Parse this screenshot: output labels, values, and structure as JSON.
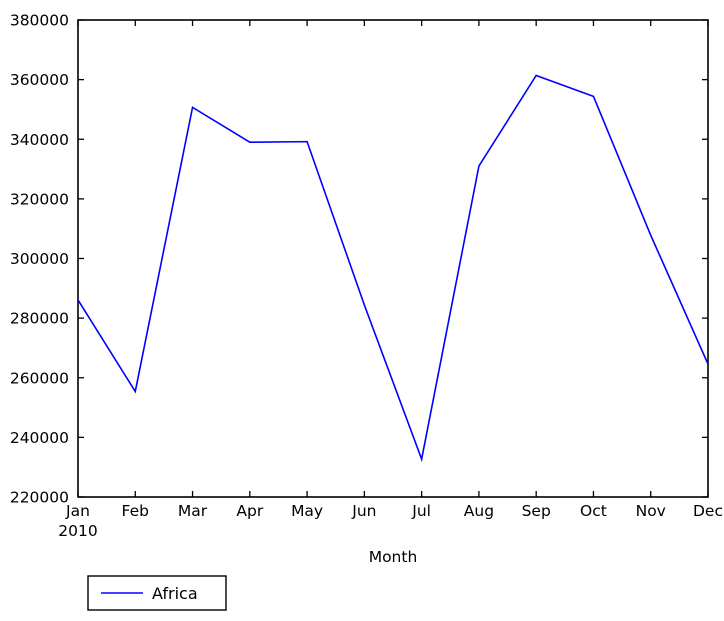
{
  "chart_data": {
    "type": "line",
    "title": "",
    "xlabel": "Month",
    "ylabel": "",
    "x_unit_label": "2010",
    "categories": [
      "Jan",
      "Feb",
      "Mar",
      "Apr",
      "May",
      "Jun",
      "Jul",
      "Aug",
      "Sep",
      "Oct",
      "Nov",
      "Dec"
    ],
    "xtick_labels": [
      "Jan",
      "Feb",
      "Mar",
      "Apr",
      "May",
      "Jun",
      "Jul",
      "Aug",
      "Sep",
      "Oct",
      "Nov",
      "Dec"
    ],
    "ytick_labels": [
      "220000",
      "240000",
      "260000",
      "280000",
      "300000",
      "320000",
      "340000",
      "360000",
      "380000"
    ],
    "yticks": [
      220000,
      240000,
      260000,
      280000,
      300000,
      320000,
      340000,
      360000,
      380000
    ],
    "ylim": [
      220000,
      380000
    ],
    "grid": false,
    "legend_position": "below-left",
    "series": [
      {
        "name": "Africa",
        "color": "#0000ff",
        "values": [
          286100,
          255400,
          350700,
          339000,
          339200,
          284400,
          232700,
          331000,
          361400,
          354400,
          307800,
          264600
        ]
      }
    ]
  },
  "legend": {
    "entries": [
      {
        "label": "Africa",
        "color": "#0000ff"
      }
    ]
  },
  "axes": {
    "x_axis_label": "Month",
    "x_axis_sublabel": "2010"
  }
}
